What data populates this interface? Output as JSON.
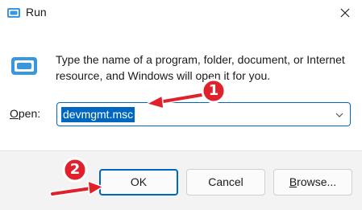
{
  "window": {
    "title": "Run",
    "icon": "run-app-icon",
    "close_icon": "close-icon"
  },
  "dialog": {
    "description": "Type the name of a program, folder, document, or Internet resource, and Windows will open it for you.",
    "open_label_accel": "O",
    "open_label_rest": "pen:",
    "open_value": "devmgmt.msc",
    "dropdown_icon": "chevron-down-icon"
  },
  "buttons": {
    "ok": "OK",
    "cancel": "Cancel",
    "browse_accel": "B",
    "browse_rest": "rowse..."
  },
  "annotations": {
    "step1": "1",
    "step2": "2",
    "marker_color": "#e0212b",
    "marker_border": "#ffffff"
  },
  "colors": {
    "accent": "#0067c0",
    "footer_bg": "#f3f3f3"
  }
}
